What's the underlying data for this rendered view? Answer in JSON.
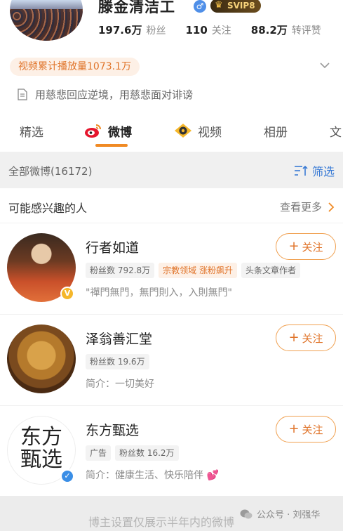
{
  "profile": {
    "name": "滕金清洁工",
    "vip": "SVIP8",
    "stats": [
      {
        "value": "197.6万",
        "label": "粉丝"
      },
      {
        "value": "110",
        "label": "关注"
      },
      {
        "value": "88.2万",
        "label": "转评赞"
      }
    ],
    "play_count": "视频累计播放量1073.1万",
    "bio": "用慈悲回应逆境，用慈悲面对诽谤"
  },
  "tabs": [
    {
      "label": "精选"
    },
    {
      "label": "微博"
    },
    {
      "label": "视频"
    },
    {
      "label": "相册"
    },
    {
      "label": "文"
    }
  ],
  "filter_bar": {
    "title": "全部微博(16172)",
    "filter_label": "筛选"
  },
  "recommend": {
    "title": "可能感兴趣的人",
    "more_label": "查看更多",
    "follow_label": "关注",
    "items": [
      {
        "name": "行者如道",
        "tags": [
          "粉丝数 792.8万",
          "宗教领域 涨粉飙升",
          "头条文章作者"
        ],
        "desc": "\"禪門無門，無門則入，入則無門\""
      },
      {
        "name": "泽翁善汇堂",
        "tags": [
          "粉丝数 19.6万"
        ],
        "desc": "简介：一切美好"
      },
      {
        "name": "东方甄选",
        "tags": [
          "广告",
          "粉丝数 16.2万"
        ],
        "desc": "简介：健康生活、快乐陪伴",
        "avatar_text": "东方甄选"
      }
    ]
  },
  "footer": {
    "text": "博主设置仅展示半年内的微博"
  },
  "watermark": "公众号 · 刘强华",
  "colors": {
    "accent": "#f08a24",
    "link": "#3a7bd5",
    "tag_orange_bg": "#fdf0e6",
    "tag_orange_fg": "#e0742a"
  }
}
